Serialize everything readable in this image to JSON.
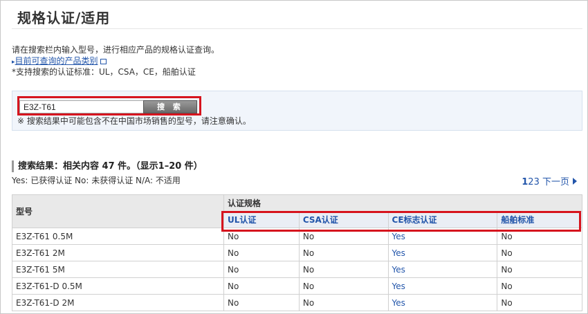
{
  "page": {
    "title": "规格认证/适用"
  },
  "intro": {
    "line1": "请在搜索栏内输入型号，进行相应产品的规格认证查询。",
    "link_label": "目前可查询的产品类别",
    "line3": "*支持搜索的认证标准：UL，CSA，CE，船舶认证"
  },
  "search": {
    "value": "E3Z-T61",
    "button_label": "搜 索",
    "note": "※ 搜索结果中可能包含不在中国市场销售的型号，请注意确认。"
  },
  "results": {
    "heading": "搜索结果：相关内容 47 件。（显示1–20 件）",
    "legend": "Yes: 已获得认证 No: 未获得认证 N/A: 不适用",
    "pagination": {
      "pages": [
        "1",
        "2",
        "3"
      ],
      "current": "1",
      "next_label": "下一页"
    }
  },
  "table": {
    "model_header": "型号",
    "group_header": "认证规格",
    "columns": [
      "UL认证",
      "CSA认证",
      "CE标志认证",
      "船舶标准"
    ],
    "rows": [
      {
        "model": "E3Z-T61 0.5M",
        "ul": "No",
        "csa": "No",
        "ce": "Yes",
        "ship": "No"
      },
      {
        "model": "E3Z-T61 2M",
        "ul": "No",
        "csa": "No",
        "ce": "Yes",
        "ship": "No"
      },
      {
        "model": "E3Z-T61 5M",
        "ul": "No",
        "csa": "No",
        "ce": "Yes",
        "ship": "No"
      },
      {
        "model": "E3Z-T61-D 0.5M",
        "ul": "No",
        "csa": "No",
        "ce": "Yes",
        "ship": "No"
      },
      {
        "model": "E3Z-T61-D 2M",
        "ul": "No",
        "csa": "No",
        "ce": "Yes",
        "ship": "No"
      }
    ]
  },
  "colors": {
    "link": "#2255aa",
    "highlight": "#d6141e",
    "panel": "#f1f5fb"
  }
}
